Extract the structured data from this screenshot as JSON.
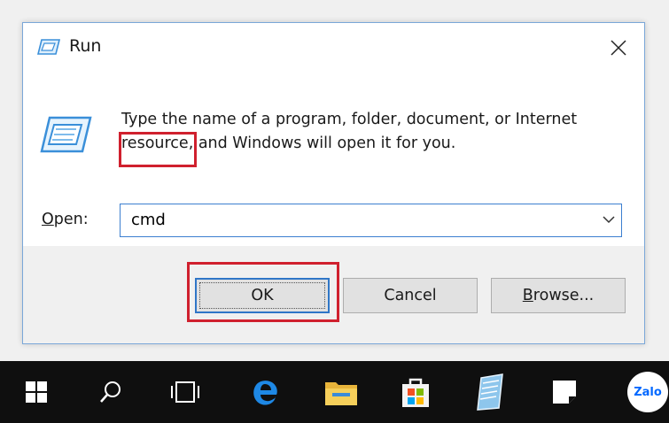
{
  "dialog": {
    "title": "Run",
    "description": "Type the name of a program, folder, document, or Internet resource, and Windows will open it for you.",
    "open_label_prefix": "O",
    "open_label_rest": "pen:",
    "open_value": "cmd",
    "buttons": {
      "ok": "OK",
      "cancel": "Cancel",
      "browse_prefix": "B",
      "browse_rest": "rowse..."
    }
  },
  "taskbar": {
    "icons": [
      "windows-start-icon",
      "search-icon",
      "task-view-icon",
      "edge-icon",
      "file-explorer-icon",
      "store-icon",
      "notepad-icon",
      "sticky-notes-icon",
      "zalo-icon"
    ],
    "zalo_label": "Zalo"
  },
  "colors": {
    "highlight": "#d0202e",
    "accent": "#2f76c7",
    "taskbar": "#0f0f0f"
  }
}
